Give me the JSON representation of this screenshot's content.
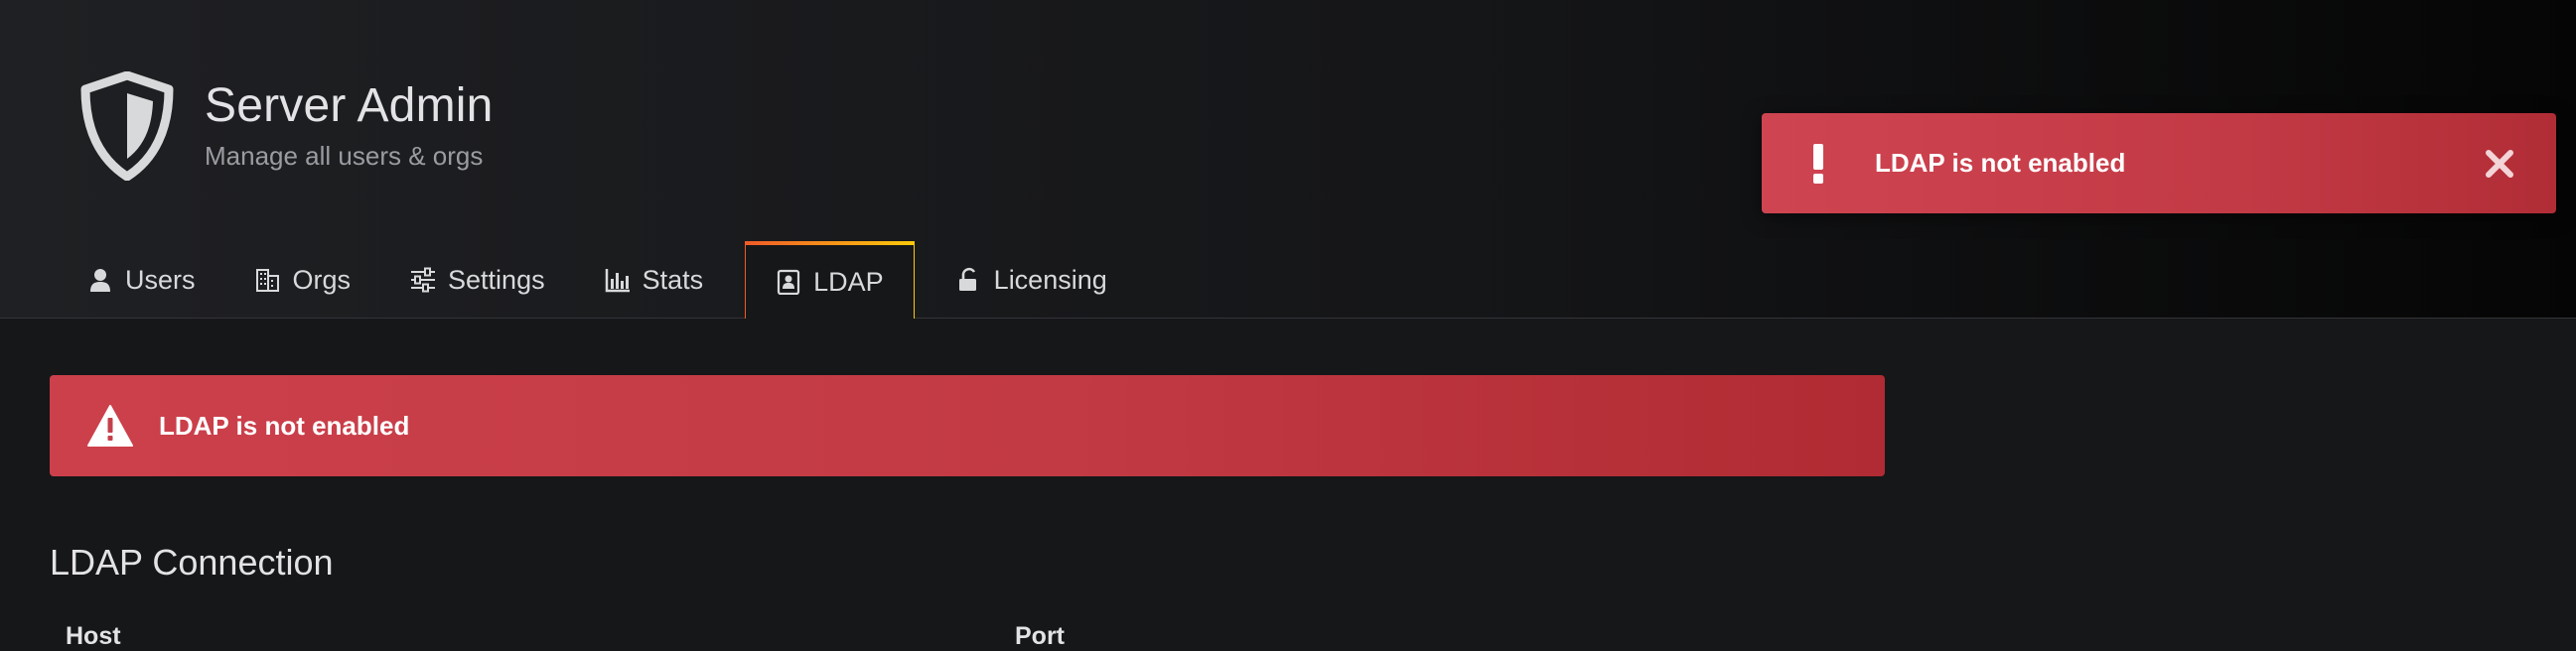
{
  "header": {
    "title": "Server Admin",
    "subtitle": "Manage all users & orgs",
    "icon": "shield-icon"
  },
  "tabs": [
    {
      "label": "Users",
      "icon": "user-icon",
      "active": false
    },
    {
      "label": "Orgs",
      "icon": "building-icon",
      "active": false
    },
    {
      "label": "Settings",
      "icon": "sliders-icon",
      "active": false
    },
    {
      "label": "Stats",
      "icon": "bar-chart-icon",
      "active": false
    },
    {
      "label": "LDAP",
      "icon": "contact-card-icon",
      "active": true
    },
    {
      "label": "Licensing",
      "icon": "unlock-icon",
      "active": false
    }
  ],
  "alert": {
    "text": "LDAP is not enabled",
    "icon": "warning-triangle-icon"
  },
  "toast": {
    "text": "LDAP is not enabled",
    "icon": "exclamation-icon",
    "close_icon": "close-icon"
  },
  "ldap_connection": {
    "title": "LDAP Connection",
    "columns": [
      "Host",
      "Port"
    ]
  },
  "colors": {
    "error": "#c4404b",
    "tab_accent_start": "#f05a28",
    "tab_accent_end": "#fbca0a",
    "background": "#161719"
  }
}
